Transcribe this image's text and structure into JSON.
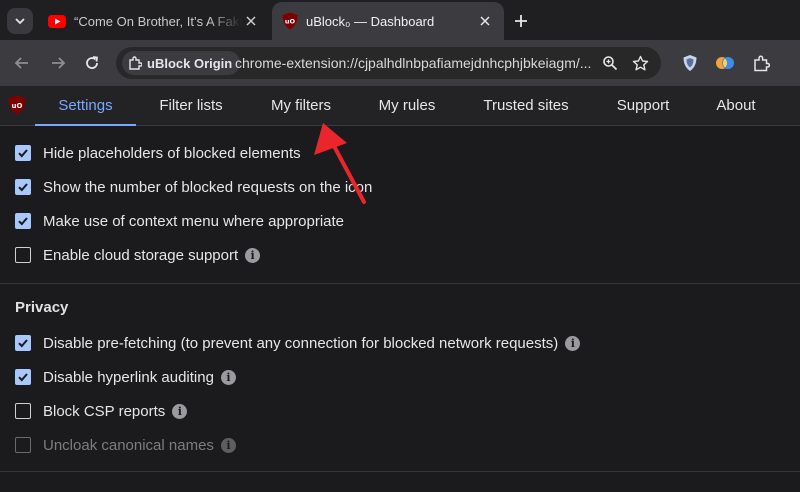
{
  "tabs": [
    {
      "title": "“Come On Brother, It’s A Fake Lover”",
      "icon": "youtube-icon",
      "active": false
    },
    {
      "title": "uBlock₀ — Dashboard",
      "icon": "ublock-icon",
      "active": true
    }
  ],
  "toolbar": {
    "chip_label": "uBlock Origin",
    "url": "chrome-extension://cjpalhdlnbpafiamejdnhcphjbkeiagm/..."
  },
  "nav": {
    "tabs": [
      "Settings",
      "Filter lists",
      "My filters",
      "My rules",
      "Trusted sites",
      "Support",
      "About"
    ],
    "selected": "Settings"
  },
  "settings": {
    "appearance": [
      {
        "label": "Hide placeholders of blocked elements",
        "checked": true,
        "info": false
      },
      {
        "label": "Show the number of blocked requests on the icon",
        "checked": true,
        "info": false
      },
      {
        "label": "Make use of context menu where appropriate",
        "checked": true,
        "info": false
      },
      {
        "label": "Enable cloud storage support",
        "checked": false,
        "info": true
      }
    ],
    "privacy_title": "Privacy",
    "privacy": [
      {
        "label": "Disable pre-fetching (to prevent any connection for blocked network requests)",
        "checked": true,
        "info": true
      },
      {
        "label": "Disable hyperlink auditing",
        "checked": true,
        "info": true
      },
      {
        "label": "Block CSP reports",
        "checked": false,
        "info": true
      },
      {
        "label": "Uncloak canonical names",
        "checked": false,
        "info": true,
        "disabled": true
      }
    ]
  },
  "annotation": {
    "type": "arrow",
    "color": "#e8262b",
    "points_to": "My filters"
  },
  "colors": {
    "accent": "#7aa7ff",
    "checkbox": "#a8c7fa",
    "youtube": "#ff0000",
    "ublock": "#800000"
  }
}
